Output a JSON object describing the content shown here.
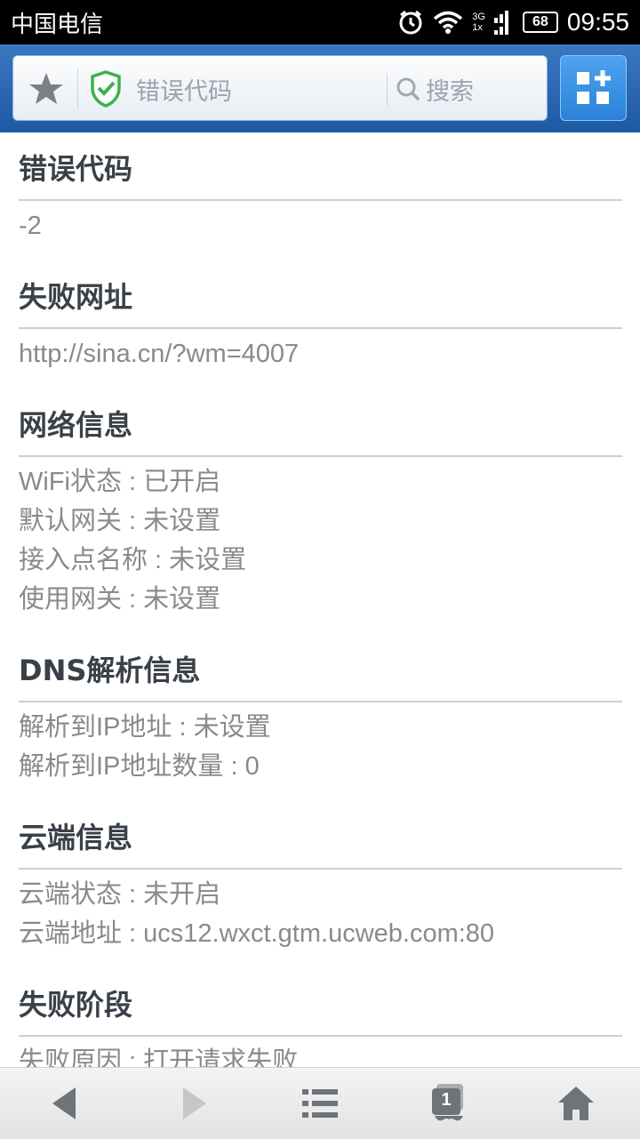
{
  "status_bar": {
    "carrier": "中国电信",
    "network_top": "3G",
    "network_bottom": "1x",
    "battery": "68",
    "time": "09:55"
  },
  "toolbar": {
    "url_title": "错误代码",
    "search_placeholder": "搜索"
  },
  "sections": [
    {
      "title": "错误代码",
      "lines": [
        "-2"
      ]
    },
    {
      "title": "失败网址",
      "lines": [
        "http://sina.cn/?wm=4007"
      ]
    },
    {
      "title": "网络信息",
      "lines": [
        "WiFi状态 : 已开启",
        "默认网关 : 未设置",
        "接入点名称 : 未设置",
        "使用网关 : 未设置"
      ]
    },
    {
      "title": "DNS解析信息",
      "lines": [
        "解析到IP地址 : 未设置",
        "解析到IP地址数量 : 0"
      ]
    },
    {
      "title": "云端信息",
      "lines": [
        "云端状态 : 未开启",
        "云端地址 : ucs12.wxct.gtm.ucweb.com:80"
      ]
    },
    {
      "title": "失败阶段",
      "lines": [
        "失败原因 : 打开请求失败"
      ]
    }
  ],
  "bottom_nav": {
    "tab_count": "1"
  },
  "colors": {
    "toolbar_blue": "#2a68b4",
    "shield_green": "#3bb34a",
    "title_text": "#3a4048",
    "body_text": "#8a8a8a"
  }
}
